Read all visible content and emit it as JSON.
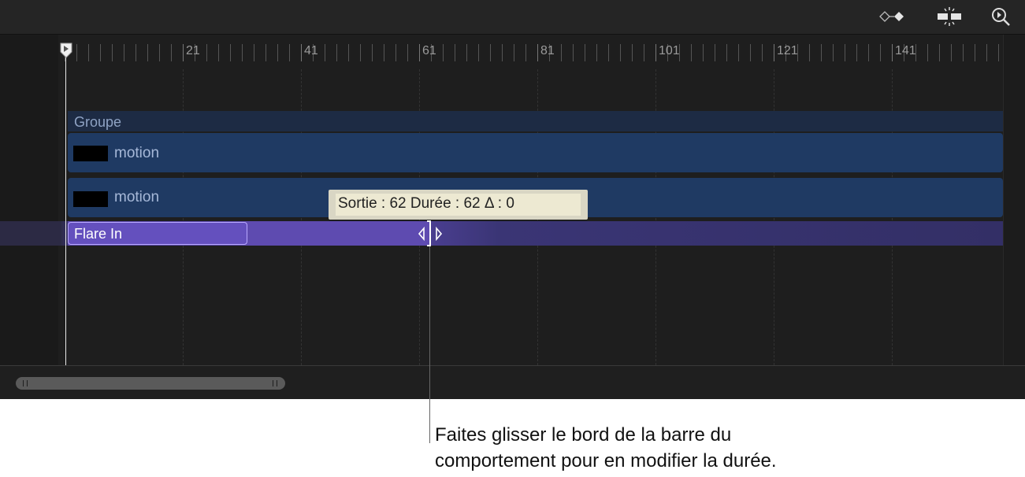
{
  "toolbar": {
    "icons": [
      "keyframe-navigation-icon",
      "snapping-icon",
      "zoom-icon"
    ]
  },
  "ruler": {
    "labels": [
      "21",
      "41",
      "61",
      "81",
      "101",
      "121",
      "141"
    ]
  },
  "tracks": {
    "group": {
      "label": "Groupe"
    },
    "layers": [
      {
        "label": "motion"
      },
      {
        "label": "motion"
      }
    ],
    "behavior": {
      "label": "Flare In"
    }
  },
  "tooltip": {
    "text": "Sortie : 62 Durée : 62 Δ : 0"
  },
  "callout": {
    "line1": "Faites glisser le bord de la barre du",
    "line2": "comportement pour en modifier la durée."
  },
  "colors": {
    "background": "#1e1e1e",
    "group": "#1d2b44",
    "layer": "#1f3a63",
    "behavior": "#5e4bb0",
    "tooltip": "#ede9d2"
  }
}
